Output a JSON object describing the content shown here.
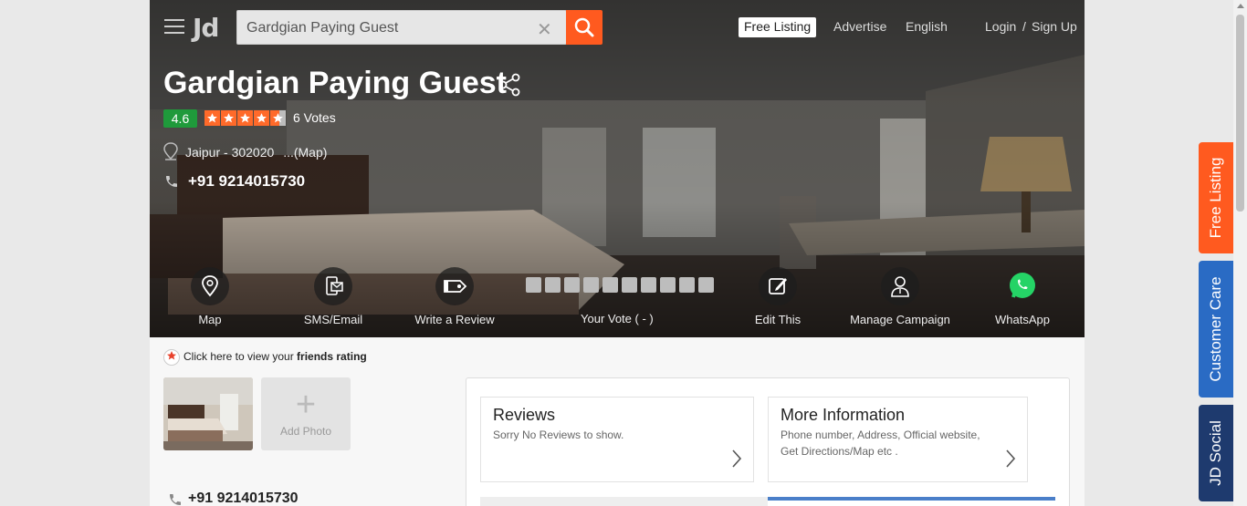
{
  "header": {
    "logo": "Jd",
    "search_value": "Gardgian Paying Guest",
    "free_listing": "Free Listing",
    "advertise": "Advertise",
    "language": "English",
    "login": "Login",
    "separator": "/",
    "signup": "Sign Up"
  },
  "listing": {
    "name": "Gardgian Paying Guest",
    "rating": "4.6",
    "stars": 4.6,
    "votes": "6 Votes",
    "address": "Jaipur - 302020",
    "map_link": "...(Map)",
    "phone": "+91 9214015730"
  },
  "actions": {
    "map": "Map",
    "sms_email": "SMS/Email",
    "write_review": "Write a Review",
    "your_vote": "Your Vote ( - )",
    "edit": "Edit This",
    "manage_campaign": "Manage Campaign",
    "whatsapp": "WhatsApp"
  },
  "body": {
    "friends_prefix": "Click here to view your ",
    "friends_bold": "friends rating",
    "add_photo": "Add Photo",
    "phone": "+91 9214015730"
  },
  "cards": {
    "reviews_title": "Reviews",
    "reviews_text": "Sorry No Reviews to show.",
    "more_title": "More Information",
    "more_text": "Phone number, Address, Official website, Get Directions/Map etc ."
  },
  "side_tabs": {
    "free_listing": "Free Listing",
    "customer_care": "Customer Care",
    "jd_social": "JD Social"
  },
  "colors": {
    "accent": "#ff5a1f",
    "rating_green": "#1f9a3b",
    "customer_care_blue": "#2a6bc4",
    "jd_social_navy": "#1e3a6e"
  }
}
